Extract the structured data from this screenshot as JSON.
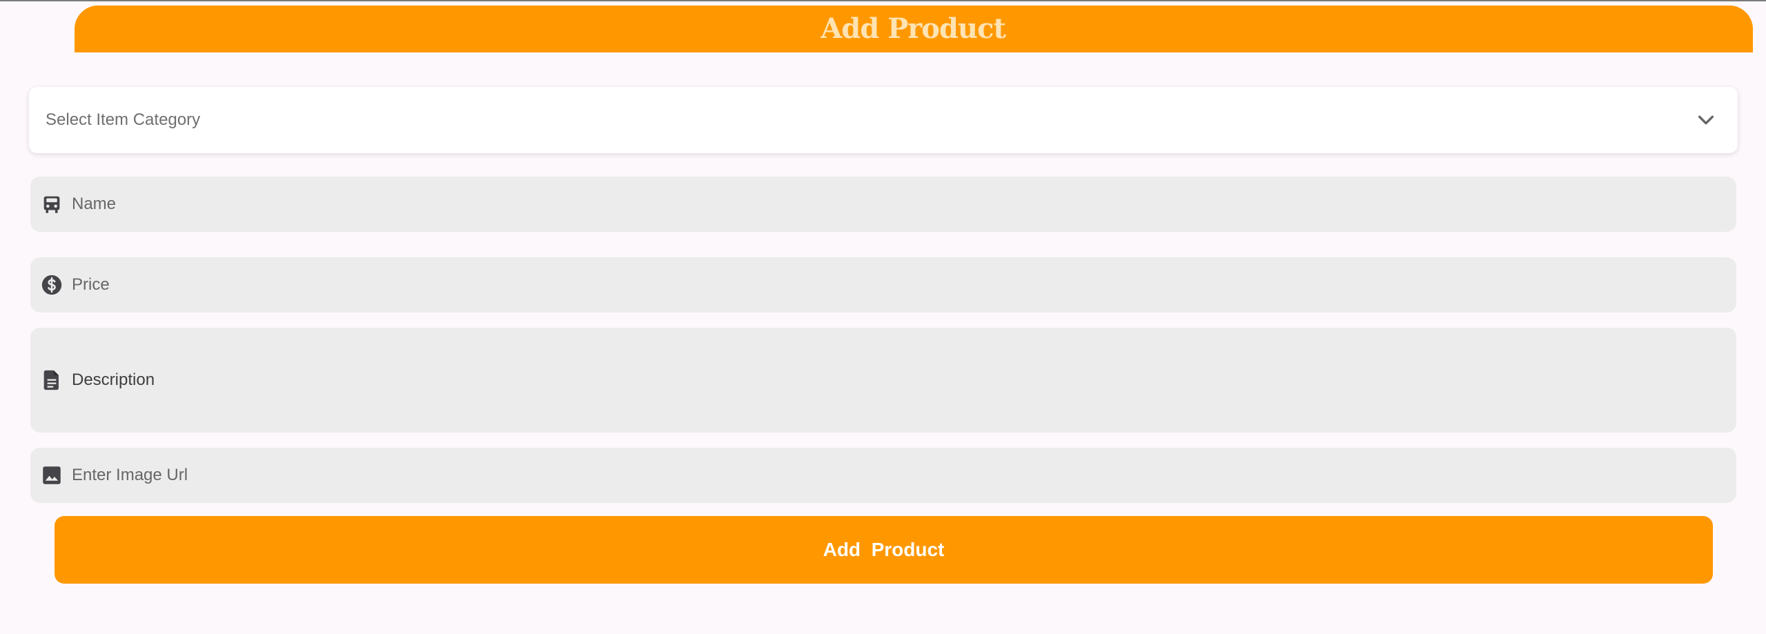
{
  "header": {
    "title": "Add Product",
    "color": "#ff9800"
  },
  "category_select": {
    "placeholder": "Select Item Category",
    "icon": "chevron-down-icon"
  },
  "fields": {
    "name": {
      "placeholder": "Name",
      "icon": "car-icon"
    },
    "price": {
      "placeholder": "Price",
      "icon": "dollar-circle-icon"
    },
    "description": {
      "placeholder": "Description",
      "icon": "document-icon"
    },
    "image_url": {
      "placeholder": "Enter Image Url",
      "icon": "image-icon"
    }
  },
  "submit": {
    "label": "Add  Product",
    "color": "#ff9800"
  }
}
